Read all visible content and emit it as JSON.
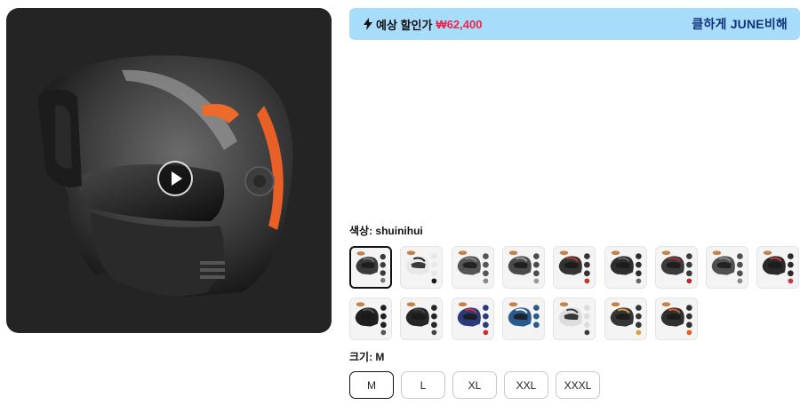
{
  "promo": {
    "label": "예상 할인가",
    "price": "₩62,400",
    "brand_text": "클하게 JUNE비해",
    "icon": "bolt-icon"
  },
  "media": {
    "play_icon": "play-icon"
  },
  "color": {
    "label": "색상: shuinihui",
    "selected_index": 0,
    "swatches": [
      {
        "tint": "#3a3a3a",
        "accent": "#777777"
      },
      {
        "tint": "#e8e8e8",
        "accent": "#1a1a1a"
      },
      {
        "tint": "#555555",
        "accent": "#888888"
      },
      {
        "tint": "#4a4a4a",
        "accent": "#999999"
      },
      {
        "tint": "#333333",
        "accent": "#c0392b"
      },
      {
        "tint": "#2e2e2e",
        "accent": "#666666"
      },
      {
        "tint": "#3b3b3b",
        "accent": "#b03030"
      },
      {
        "tint": "#505050",
        "accent": "#8a8a8a"
      },
      {
        "tint": "#2a2a2a",
        "accent": "#c43a3a"
      },
      {
        "tint": "#1f1f1f",
        "accent": "#555555"
      },
      {
        "tint": "#262626",
        "accent": "#444444"
      },
      {
        "tint": "#2b3a7a",
        "accent": "#d0302f"
      },
      {
        "tint": "#2a5a8a",
        "accent": "#f0f0f0"
      },
      {
        "tint": "#dddddd",
        "accent": "#3a3a3a"
      },
      {
        "tint": "#353535",
        "accent": "#e0a030"
      },
      {
        "tint": "#303030",
        "accent": "#e06020"
      }
    ]
  },
  "size": {
    "label": "크기: M",
    "options": [
      "M",
      "L",
      "XL",
      "XXL",
      "XXXL"
    ],
    "selected": "M"
  }
}
